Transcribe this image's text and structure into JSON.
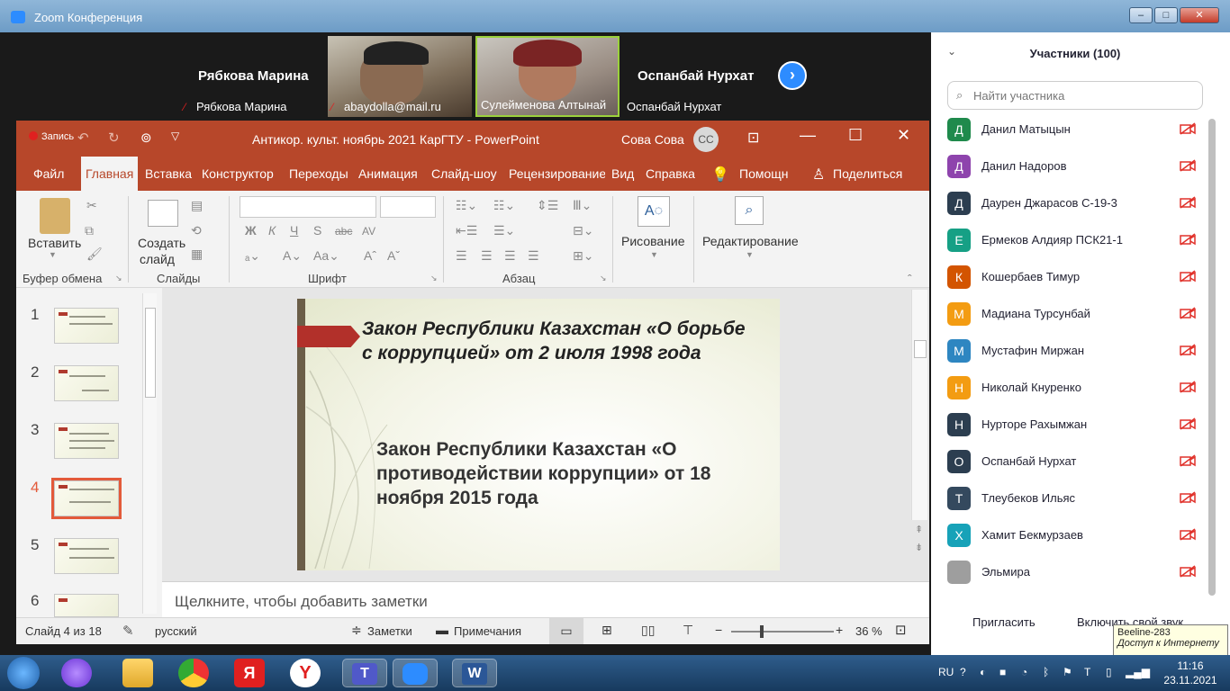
{
  "zoom": {
    "title": "Zoom Конференция",
    "tiles": [
      {
        "big_name": "Рябкова Марина",
        "label": "Рябкова Марина"
      },
      {
        "big_name": "",
        "label": "abaydolla@mail.ru"
      },
      {
        "big_name": "",
        "label": "Сулейменова Алтынай"
      },
      {
        "big_name": "Оспанбай Нурхат",
        "label": "Оспанбай Нурхат"
      }
    ]
  },
  "ppt": {
    "record_label": "Запись",
    "title": "Антикор. культ. ноябрь 2021 КарГТУ  -  PowerPoint",
    "user_name": "Сова Сова",
    "user_initials": "СС",
    "tabs": [
      "Файл",
      "Главная",
      "Вставка",
      "Конструктор",
      "Переходы",
      "Анимация",
      "Слайд-шоу",
      "Рецензирование",
      "Вид",
      "Справка"
    ],
    "help_label": "Помощн",
    "share_label": "Поделиться",
    "ribbon": {
      "paste": "Вставить",
      "create_slide_1": "Создать",
      "create_slide_2": "слайд",
      "drawing": "Рисование",
      "editing": "Редактирование",
      "groups": [
        "Буфер обмена",
        "Слайды",
        "Шрифт",
        "Абзац"
      ],
      "font_buttons": [
        "Ж",
        "К",
        "Ч",
        "S",
        "abc",
        "AV"
      ]
    },
    "slide_numbers": [
      "1",
      "2",
      "3",
      "4",
      "5",
      "6"
    ],
    "slide": {
      "title": "Закон Республики Казахстан «О борьбе с коррупцией» от 2 июля 1998 года",
      "body": "Закон Республики Казахстан «О противодействии коррупции» от 18 ноября 2015 года"
    },
    "notes_placeholder": "Щелкните, чтобы добавить заметки",
    "status": {
      "slide_counter": "Слайд 4 из 18",
      "language": "русский",
      "notes": "Заметки",
      "comments": "Примечания",
      "zoom": "36 %"
    }
  },
  "participants": {
    "title": "Участники (100)",
    "search_placeholder": "Найти участника",
    "list": [
      {
        "initial": "Д",
        "name": "Данил Матыцын",
        "color": "#1f8a4c"
      },
      {
        "initial": "Д",
        "name": "Данил Надоров",
        "color": "#8e44ad"
      },
      {
        "initial": "Д",
        "name": "Даурен Джарасов С-19-3",
        "color": "#2c3e50"
      },
      {
        "initial": "Е",
        "name": "Ермеков Алдияр ПСК21-1",
        "color": "#16a085"
      },
      {
        "initial": "К",
        "name": "Кошербаев Тимур",
        "color": "#d35400"
      },
      {
        "initial": "М",
        "name": "Мадиана Турсунбай",
        "color": "#f39c12"
      },
      {
        "initial": "М",
        "name": "Мустафин Миржан",
        "color": "#2e86c1"
      },
      {
        "initial": "Н",
        "name": "Николай Кнуренко",
        "color": "#f39c12"
      },
      {
        "initial": "Н",
        "name": "Нурторе Рахымжан",
        "color": "#2c3e50"
      },
      {
        "initial": "О",
        "name": "Оспанбай Нурхат",
        "color": "#2c3e50"
      },
      {
        "initial": "Т",
        "name": "Тлеубеков Ильяс",
        "color": "#34495e"
      },
      {
        "initial": "Х",
        "name": "Хамит Бекмурзаев",
        "color": "#17a2b8"
      },
      {
        "initial": "",
        "name": "Эльмира",
        "color": "#9e9e9e"
      }
    ],
    "invite": "Пригласить",
    "unmute": "Включить свой звук"
  },
  "tooltip": {
    "line1": "Beeline-283",
    "line2": "Доступ к Интернету"
  },
  "taskbar": {
    "lang": "RU",
    "time": "11:16",
    "date": "23.11.2021"
  }
}
